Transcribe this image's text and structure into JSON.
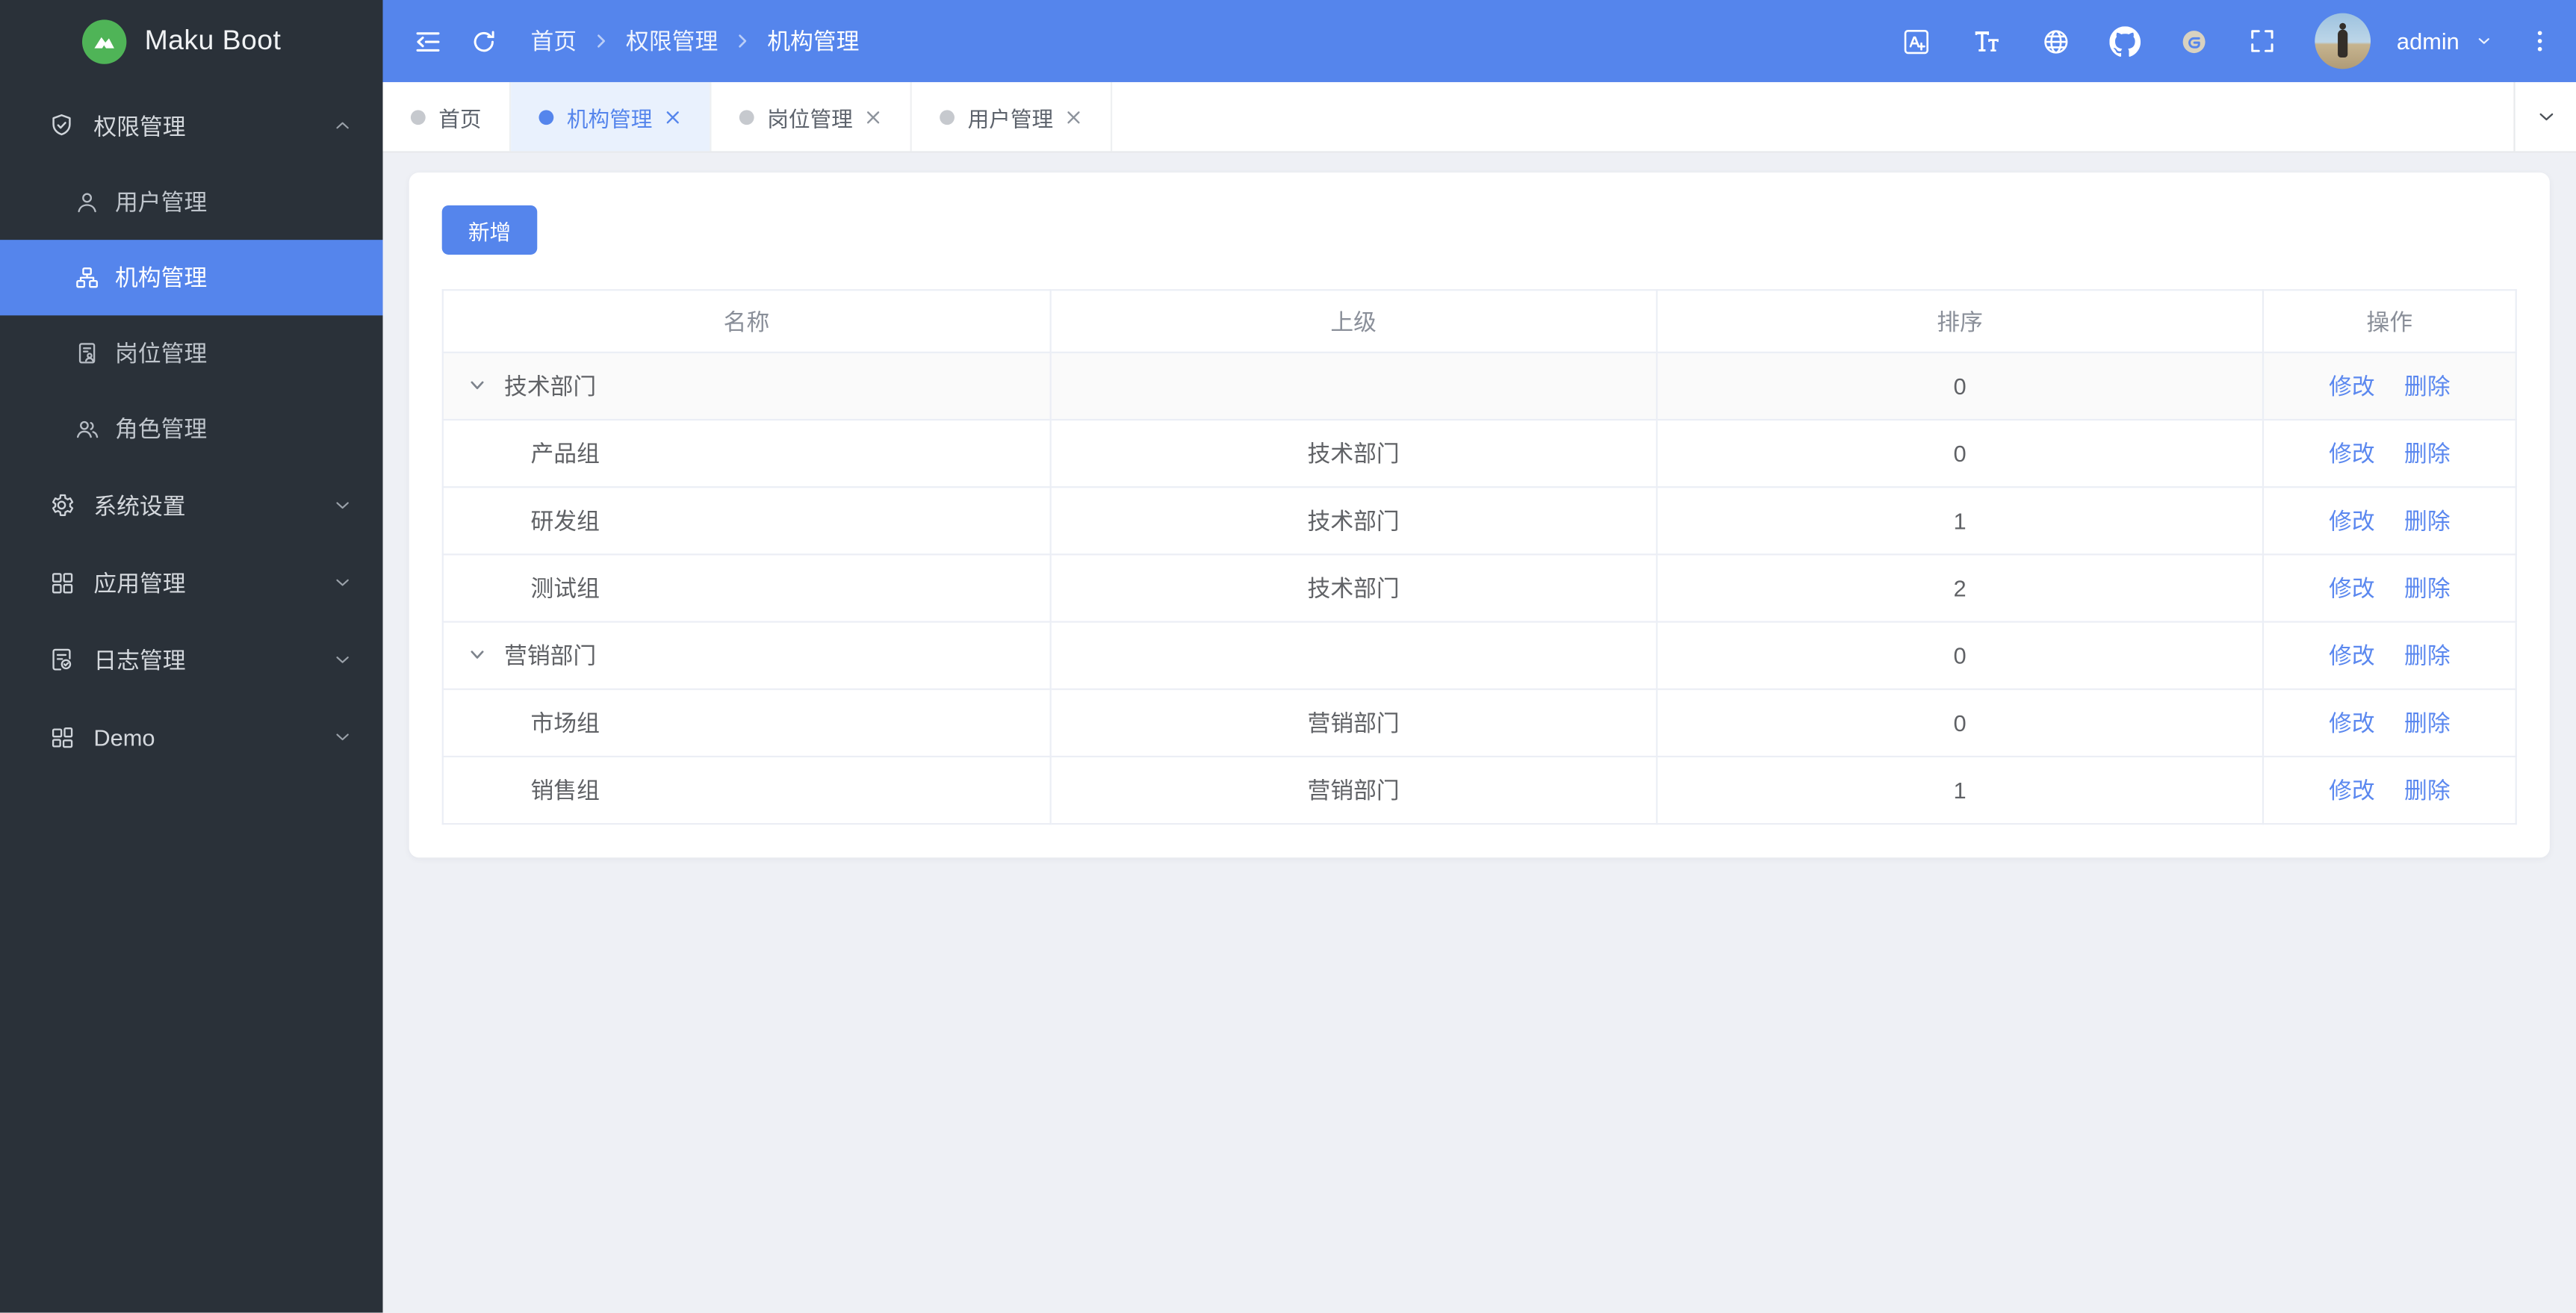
{
  "app": {
    "name": "Maku Boot"
  },
  "topbar": {
    "breadcrumb": [
      "首页",
      "权限管理",
      "机构管理"
    ],
    "username": "admin"
  },
  "sidebar": {
    "groups": [
      {
        "label": "权限管理",
        "expanded": true,
        "children": [
          {
            "label": "用户管理",
            "active": false
          },
          {
            "label": "机构管理",
            "active": true
          },
          {
            "label": "岗位管理",
            "active": false
          },
          {
            "label": "角色管理",
            "active": false
          }
        ]
      },
      {
        "label": "系统设置",
        "expanded": false
      },
      {
        "label": "应用管理",
        "expanded": false
      },
      {
        "label": "日志管理",
        "expanded": false
      },
      {
        "label": "Demo",
        "expanded": false
      }
    ]
  },
  "tabs": [
    {
      "label": "首页",
      "active": false,
      "closable": false
    },
    {
      "label": "机构管理",
      "active": true,
      "closable": true
    },
    {
      "label": "岗位管理",
      "active": false,
      "closable": true
    },
    {
      "label": "用户管理",
      "active": false,
      "closable": true
    }
  ],
  "toolbar": {
    "add_label": "新增"
  },
  "table": {
    "columns": [
      "名称",
      "上级",
      "排序",
      "操作"
    ],
    "actions": {
      "edit": "修改",
      "delete": "删除"
    },
    "rows": [
      {
        "name": "技术部门",
        "parent": "",
        "sort": 0,
        "level": 0,
        "expanded": true,
        "hovered": true
      },
      {
        "name": "产品组",
        "parent": "技术部门",
        "sort": 0,
        "level": 1
      },
      {
        "name": "研发组",
        "parent": "技术部门",
        "sort": 1,
        "level": 1
      },
      {
        "name": "测试组",
        "parent": "技术部门",
        "sort": 2,
        "level": 1
      },
      {
        "name": "营销部门",
        "parent": "",
        "sort": 0,
        "level": 0,
        "expanded": true
      },
      {
        "name": "市场组",
        "parent": "营销部门",
        "sort": 0,
        "level": 1
      },
      {
        "name": "销售组",
        "parent": "营销部门",
        "sort": 1,
        "level": 1
      }
    ]
  },
  "icons": {
    "logo": "mountain-icon",
    "header_left": [
      "menu-fold-icon",
      "refresh-icon"
    ],
    "header_right": [
      "translate-icon",
      "font-size-icon",
      "globe-icon",
      "github-icon",
      "gitee-icon",
      "fullscreen-icon",
      "avatar",
      "chevron-down-icon",
      "kebab-menu-icon"
    ],
    "sidebar": [
      "shield-check-icon",
      "user-icon",
      "org-tree-icon",
      "post-doc-icon",
      "roles-icon",
      "gear-icon",
      "apps-grid-icon",
      "log-file-icon",
      "demo-grid-icon"
    ]
  },
  "colors": {
    "primary": "#5585ec",
    "sidebar_bg": "#2a3139",
    "page_bg": "#eef0f5",
    "card_bg": "#ffffff",
    "logo_green": "#4fb457",
    "table_border": "#ebeef5",
    "link": "#5b88ef",
    "tab_active_bg": "#e9f1fd",
    "hover_row_bg": "#fafafa"
  }
}
